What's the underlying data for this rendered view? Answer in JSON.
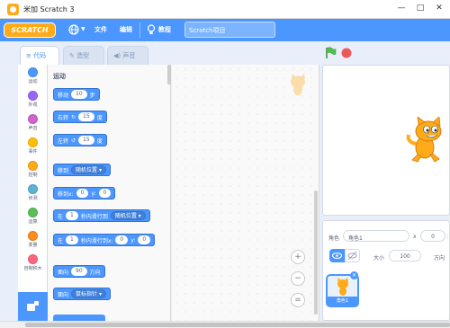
{
  "window": {
    "title": "米加 Scratch 3",
    "minimize": "—",
    "maximize": "□",
    "close": "✕"
  },
  "menu": {
    "logo": "SCRATCH",
    "file": "文件",
    "edit": "编辑",
    "tutorials": "教程",
    "project_title": "Scratch项目"
  },
  "tabs": {
    "code": "代码",
    "costumes": "造型",
    "sounds": "声音"
  },
  "categories": [
    {
      "label": "运动",
      "color": "#4c97ff"
    },
    {
      "label": "外观",
      "color": "#9966ff"
    },
    {
      "label": "声音",
      "color": "#cf63cf"
    },
    {
      "label": "事件",
      "color": "#ffbf00"
    },
    {
      "label": "控制",
      "color": "#ffab19"
    },
    {
      "label": "侦测",
      "color": "#5cb1d6"
    },
    {
      "label": "运算",
      "color": "#59c059"
    },
    {
      "label": "变量",
      "color": "#ff8c1a"
    },
    {
      "label": "自制积木",
      "color": "#ff6680"
    }
  ],
  "palette": {
    "heading": "运动",
    "b1": {
      "t1": "移动",
      "v1": "10",
      "t2": "步"
    },
    "b2": {
      "t1": "右转",
      "v1": "15",
      "t2": "度"
    },
    "b3": {
      "t1": "左转",
      "v1": "15",
      "t2": "度"
    },
    "b4": {
      "t1": "移到",
      "dd": "随机位置"
    },
    "b5": {
      "t1": "移到x:",
      "v1": "0",
      "t2": "y:",
      "v2": "0"
    },
    "b6": {
      "t1": "在",
      "v1": "1",
      "t2": "秒内滑行到",
      "dd": "随机位置"
    },
    "b7": {
      "t1": "在",
      "v1": "1",
      "t2": "秒内滑行到x:",
      "v2": "0",
      "t3": "y:",
      "v3": "0"
    },
    "b8": {
      "t1": "面向",
      "v1": "90",
      "t2": "方向"
    },
    "b9": {
      "t1": "面向",
      "dd": "鼠标指针"
    }
  },
  "zoom": {
    "in": "+",
    "out": "−",
    "reset": "="
  },
  "sprite_info": {
    "sprite_label": "角色",
    "sprite_name": "角色1",
    "x_label": "x",
    "x_value": "0",
    "size_label": "大小",
    "size_value": "100",
    "direction_label": "方向"
  },
  "sprite_list": [
    {
      "name": "角色1"
    }
  ],
  "colors": {
    "menu_blue": "#4c97ff",
    "green_flag": "#4cbf56",
    "stop": "#ec5959"
  }
}
